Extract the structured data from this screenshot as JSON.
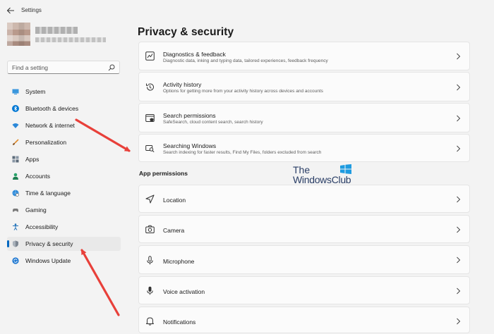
{
  "window": {
    "title": "Settings"
  },
  "search": {
    "placeholder": "Find a setting"
  },
  "sidebar": {
    "items": [
      {
        "label": "System",
        "icon": "monitor-icon"
      },
      {
        "label": "Bluetooth & devices",
        "icon": "bluetooth-icon"
      },
      {
        "label": "Network & internet",
        "icon": "wifi-icon"
      },
      {
        "label": "Personalization",
        "icon": "brush-icon"
      },
      {
        "label": "Apps",
        "icon": "apps-icon"
      },
      {
        "label": "Accounts",
        "icon": "person-icon"
      },
      {
        "label": "Time & language",
        "icon": "globe-clock-icon"
      },
      {
        "label": "Gaming",
        "icon": "gamepad-icon"
      },
      {
        "label": "Accessibility",
        "icon": "accessibility-icon"
      },
      {
        "label": "Privacy & security",
        "icon": "shield-icon",
        "selected": true
      },
      {
        "label": "Windows Update",
        "icon": "update-icon"
      }
    ]
  },
  "main": {
    "title": "Privacy & security",
    "security_cards": [
      {
        "title": "Diagnostics & feedback",
        "desc": "Diagnostic data, inking and typing data, tailored experiences, feedback frequency",
        "icon": "chart-icon"
      },
      {
        "title": "Activity history",
        "desc": "Options for getting more from your activity history across devices and accounts",
        "icon": "history-icon"
      },
      {
        "title": "Search permissions",
        "desc": "SafeSearch, cloud content search, search history",
        "icon": "search-permissions-icon"
      },
      {
        "title": "Searching Windows",
        "desc": "Search indexing for faster results, Find My Files, folders excluded from search",
        "icon": "searching-windows-icon"
      }
    ],
    "app_permissions_label": "App permissions",
    "app_permissions": [
      {
        "title": "Location",
        "icon": "location-icon"
      },
      {
        "title": "Camera",
        "icon": "camera-icon"
      },
      {
        "title": "Microphone",
        "icon": "microphone-icon"
      },
      {
        "title": "Voice activation",
        "icon": "voice-activation-icon"
      },
      {
        "title": "Notifications",
        "icon": "bell-icon"
      }
    ]
  },
  "watermark": {
    "line1": "The",
    "line2": "WindowsClub"
  },
  "colors": {
    "accent": "#0067c0",
    "arrow": "#e8403a",
    "background": "#f3f3f3",
    "card": "#fbfbfb"
  }
}
